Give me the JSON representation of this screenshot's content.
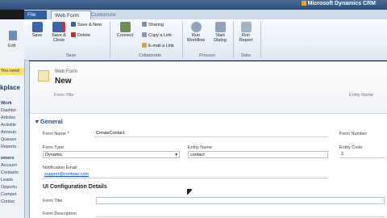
{
  "app": {
    "brand": "Microsoft Dynamics CRM"
  },
  "tabs": [
    {
      "label": "File"
    },
    {
      "label": "Web Form"
    },
    {
      "label": "Customize"
    }
  ],
  "ribbon": {
    "save": "Save",
    "save_close_1": "Save &",
    "save_close_2": "Close",
    "save_new": "Save & New",
    "delete": "Delete",
    "group_save": "Save",
    "connect": "Connect",
    "sharing": "Sharing",
    "copy_link": "Copy a Link",
    "email_link": "E-mail a Link",
    "group_collaborate": "Collaborate",
    "run_workflow_1": "Run",
    "run_workflow_2": "Workflow",
    "start_dialog_1": "Start",
    "start_dialog_2": "Dialog",
    "group_process": "Process",
    "run_report_1": "Run",
    "run_report_2": "Report",
    "group_data": "Data"
  },
  "leftnav": {
    "edit": "Edit",
    "notice": "You need",
    "heading": "kplace",
    "items": [
      "Work",
      "Dashbo",
      "Articles",
      "Activitie",
      "Announ",
      "Queues",
      "Reports",
      "omers",
      "Account",
      "Contacts",
      "Leads",
      "Opportu",
      "Compet",
      "Contac"
    ]
  },
  "form": {
    "entity_type": "Web Form",
    "entity_name": "New",
    "form_title_label": "Form Title",
    "entity_name_label": "Entity Name",
    "section_general": "General",
    "form_name_label": "Form Name *",
    "form_name_value": "CreateContact",
    "form_number_label": "Form Number",
    "form_type_label": "Form Type",
    "form_type_value": "Dynamic",
    "entity_name_field_label": "Entity Name",
    "entity_name_value": "contact",
    "entity_code_label": "Entity Code",
    "entity_code_value": "2",
    "notification_email_label": "Notification Email",
    "notification_email_value": "support@contoso.com",
    "ui_config_heading": "UI Configuration Details",
    "form_title_field_label": "Form Title",
    "form_description_label": "Form Description"
  }
}
